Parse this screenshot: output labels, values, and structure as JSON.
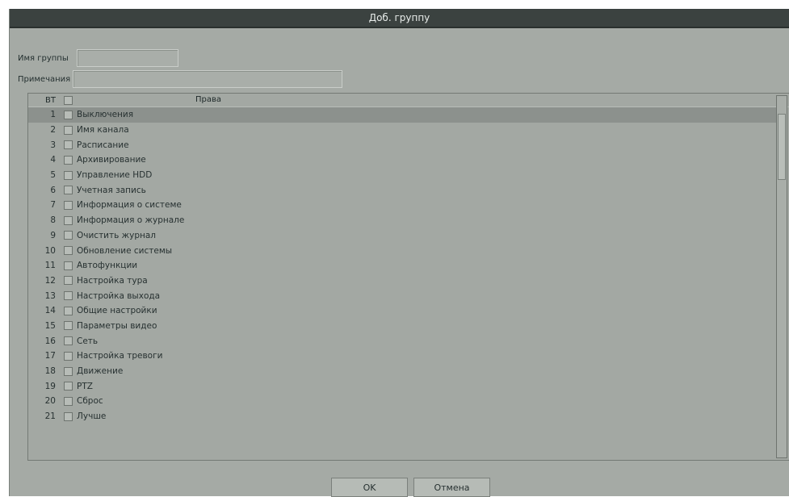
{
  "dialog": {
    "title": "Доб. группу"
  },
  "form": {
    "group_name_label": "Имя группы",
    "group_name_value": "",
    "note_label": "Примечания",
    "note_value": ""
  },
  "list": {
    "header_no": "ВТ",
    "header_title": "Права",
    "selected_row": 1,
    "rows": [
      {
        "no": "1",
        "label": "Выключения"
      },
      {
        "no": "2",
        "label": "Имя канала"
      },
      {
        "no": "3",
        "label": "Расписание"
      },
      {
        "no": "4",
        "label": "Архивирование"
      },
      {
        "no": "5",
        "label": "Управление HDD"
      },
      {
        "no": "6",
        "label": "Учетная запись"
      },
      {
        "no": "7",
        "label": "Информация о системе"
      },
      {
        "no": "8",
        "label": "Информация о журнале"
      },
      {
        "no": "9",
        "label": "Очистить журнал"
      },
      {
        "no": "10",
        "label": "Обновление системы"
      },
      {
        "no": "11",
        "label": "Автофункции"
      },
      {
        "no": "12",
        "label": "Настройка тура"
      },
      {
        "no": "13",
        "label": "Настройка выхода"
      },
      {
        "no": "14",
        "label": "Общие настройки"
      },
      {
        "no": "15",
        "label": "Параметры видео"
      },
      {
        "no": "16",
        "label": "Сеть"
      },
      {
        "no": "17",
        "label": "Настройка тревоги"
      },
      {
        "no": "18",
        "label": "Движение"
      },
      {
        "no": "19",
        "label": "PTZ"
      },
      {
        "no": "20",
        "label": "Сброс"
      },
      {
        "no": "21",
        "label": "Лучше"
      }
    ]
  },
  "buttons": {
    "ok_label": "OK",
    "cancel_label": "Отмена"
  }
}
